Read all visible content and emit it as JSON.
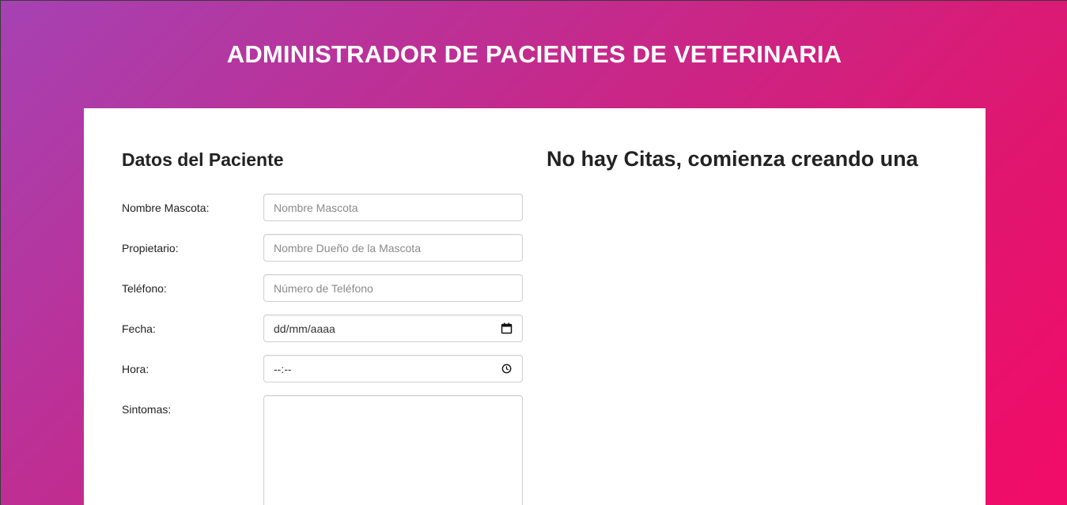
{
  "header": {
    "title": "ADMINISTRADOR DE PACIENTES DE VETERINARIA"
  },
  "form": {
    "title": "Datos del Paciente",
    "fields": {
      "mascota": {
        "label": "Nombre Mascota:",
        "placeholder": "Nombre Mascota"
      },
      "propietario": {
        "label": "Propietario:",
        "placeholder": "Nombre Dueño de la Mascota"
      },
      "telefono": {
        "label": "Teléfono:",
        "placeholder": "Número de Teléfono"
      },
      "fecha": {
        "label": "Fecha:",
        "value": "dd/mm/aaaa",
        "icon": "calendar-icon"
      },
      "hora": {
        "label": "Hora:",
        "value": "--:--",
        "icon": "clock-icon"
      },
      "sintomas": {
        "label": "Sintomas:"
      }
    }
  },
  "citas": {
    "empty_message": "No hay Citas, comienza creando una"
  },
  "colors": {
    "gradient_start": "#a542b3",
    "gradient_end": "#f20b68",
    "card": "#ffffff"
  }
}
